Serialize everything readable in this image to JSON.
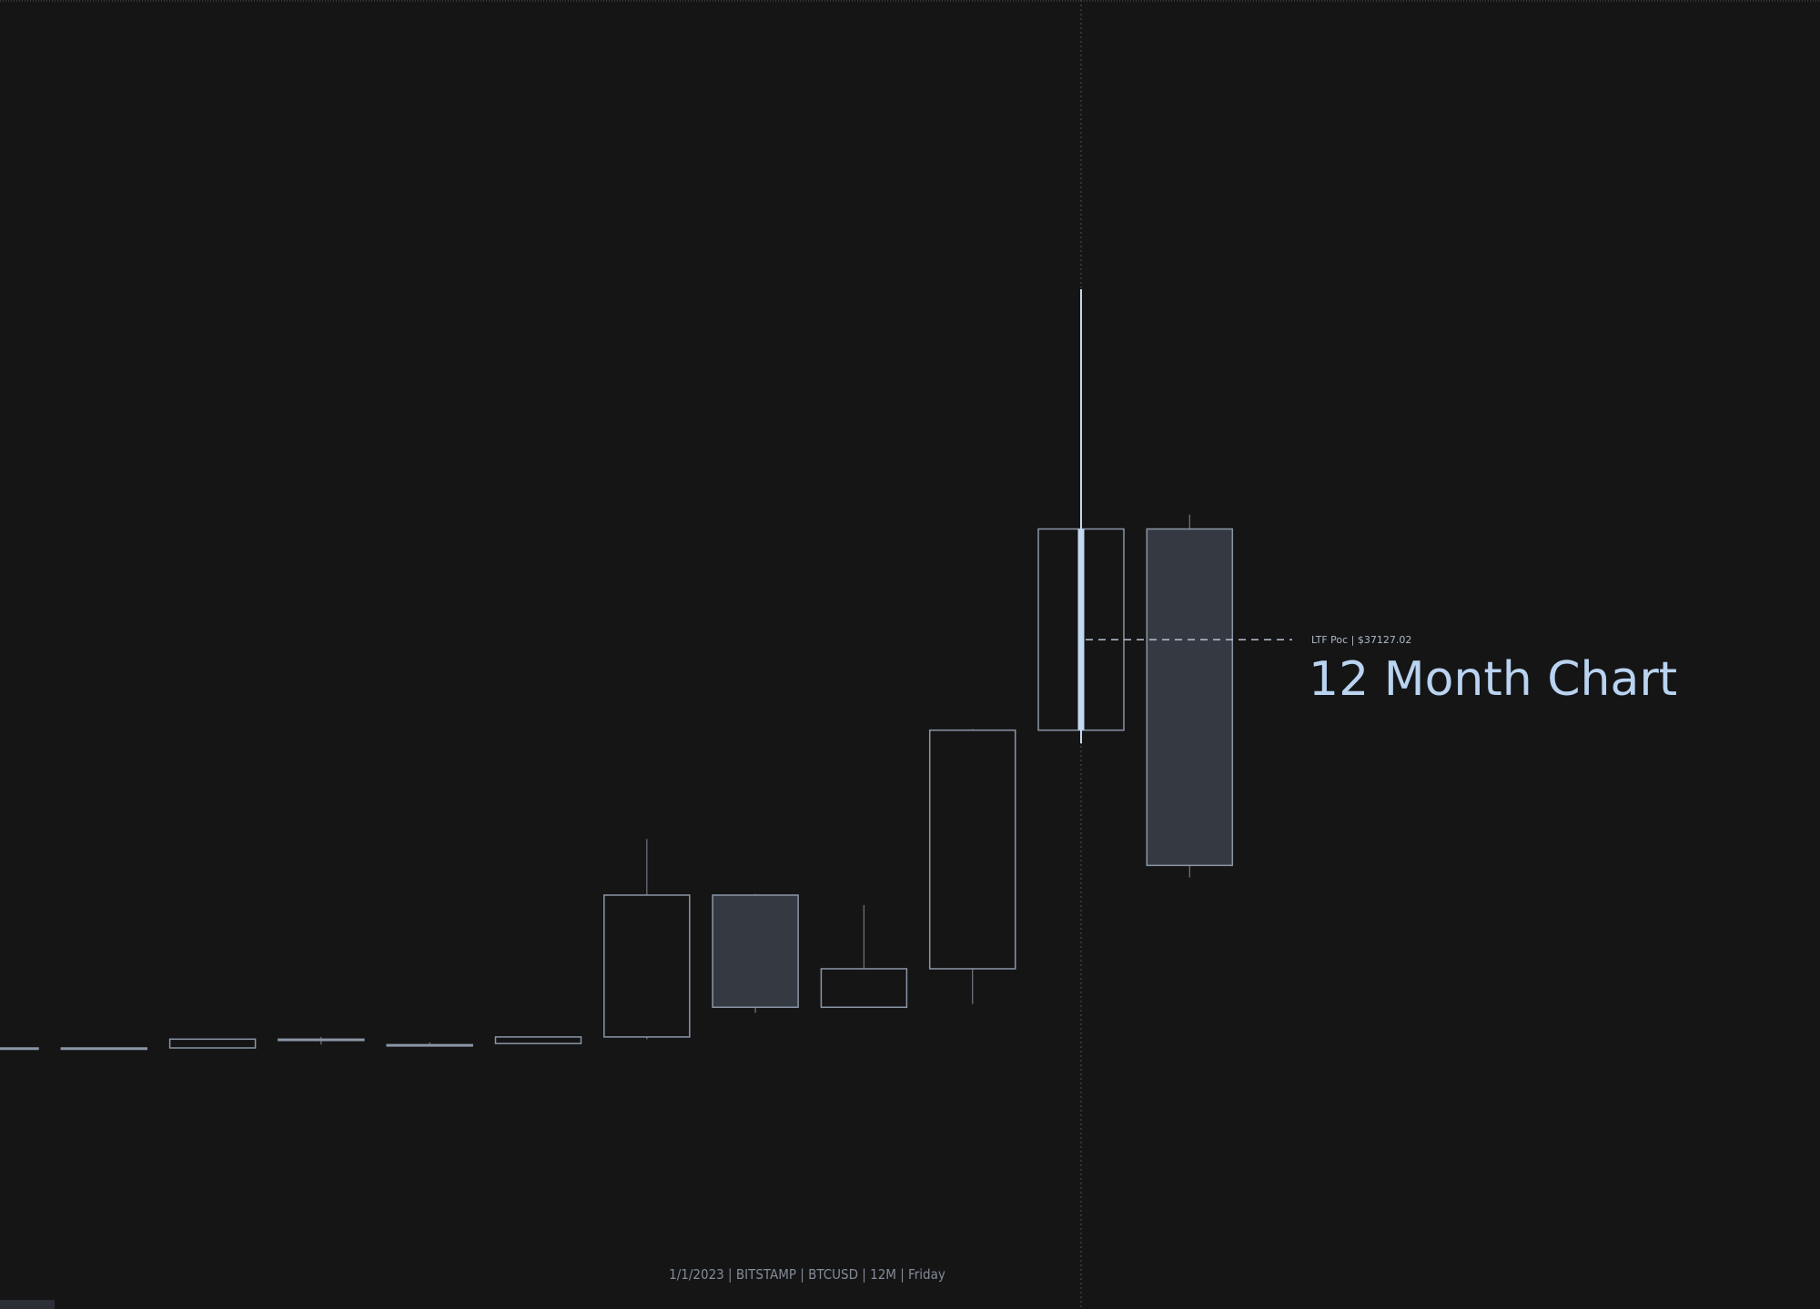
{
  "chart_data": {
    "type": "candlestick",
    "symbol": "BTCUSD",
    "timeframe": "12M",
    "title": "12 Month Chart",
    "footer": "1/1/2023 | BITSTAMP | BTCUSD | 12M | Friday",
    "poc": {
      "label": "LTF Poc  |  $37127.02",
      "value": 37127.02
    },
    "series": [
      {
        "open": 0,
        "high": 0,
        "low": 0,
        "close": 0
      },
      {
        "open": 0,
        "high": 0,
        "low": 0,
        "close": 0
      },
      {
        "open": 0,
        "high": 400,
        "low": 0,
        "close": 800
      },
      {
        "open": 800,
        "high": 1000,
        "low": 300,
        "close": 700
      },
      {
        "open": 300,
        "high": 500,
        "low": 200,
        "close": 200
      },
      {
        "open": 400,
        "high": 1000,
        "low": 400,
        "close": 1000
      },
      {
        "open": 1000,
        "high": 19000,
        "low": 800,
        "close": 13900
      },
      {
        "open": 13900,
        "high": 14000,
        "low": 3200,
        "close": 3700
      },
      {
        "open": 3700,
        "high": 13000,
        "low": 3700,
        "close": 7200
      },
      {
        "open": 7200,
        "high": 29000,
        "low": 4000,
        "close": 28900
      },
      {
        "open": 28900,
        "high": 69000,
        "low": 27700,
        "close": 47200
      },
      {
        "open": 47200,
        "high": 48500,
        "low": 15500,
        "close": 16600
      }
    ],
    "highlight_index": 10,
    "y_range": [
      0,
      69000
    ],
    "grid": false,
    "cursor_index": 10
  }
}
